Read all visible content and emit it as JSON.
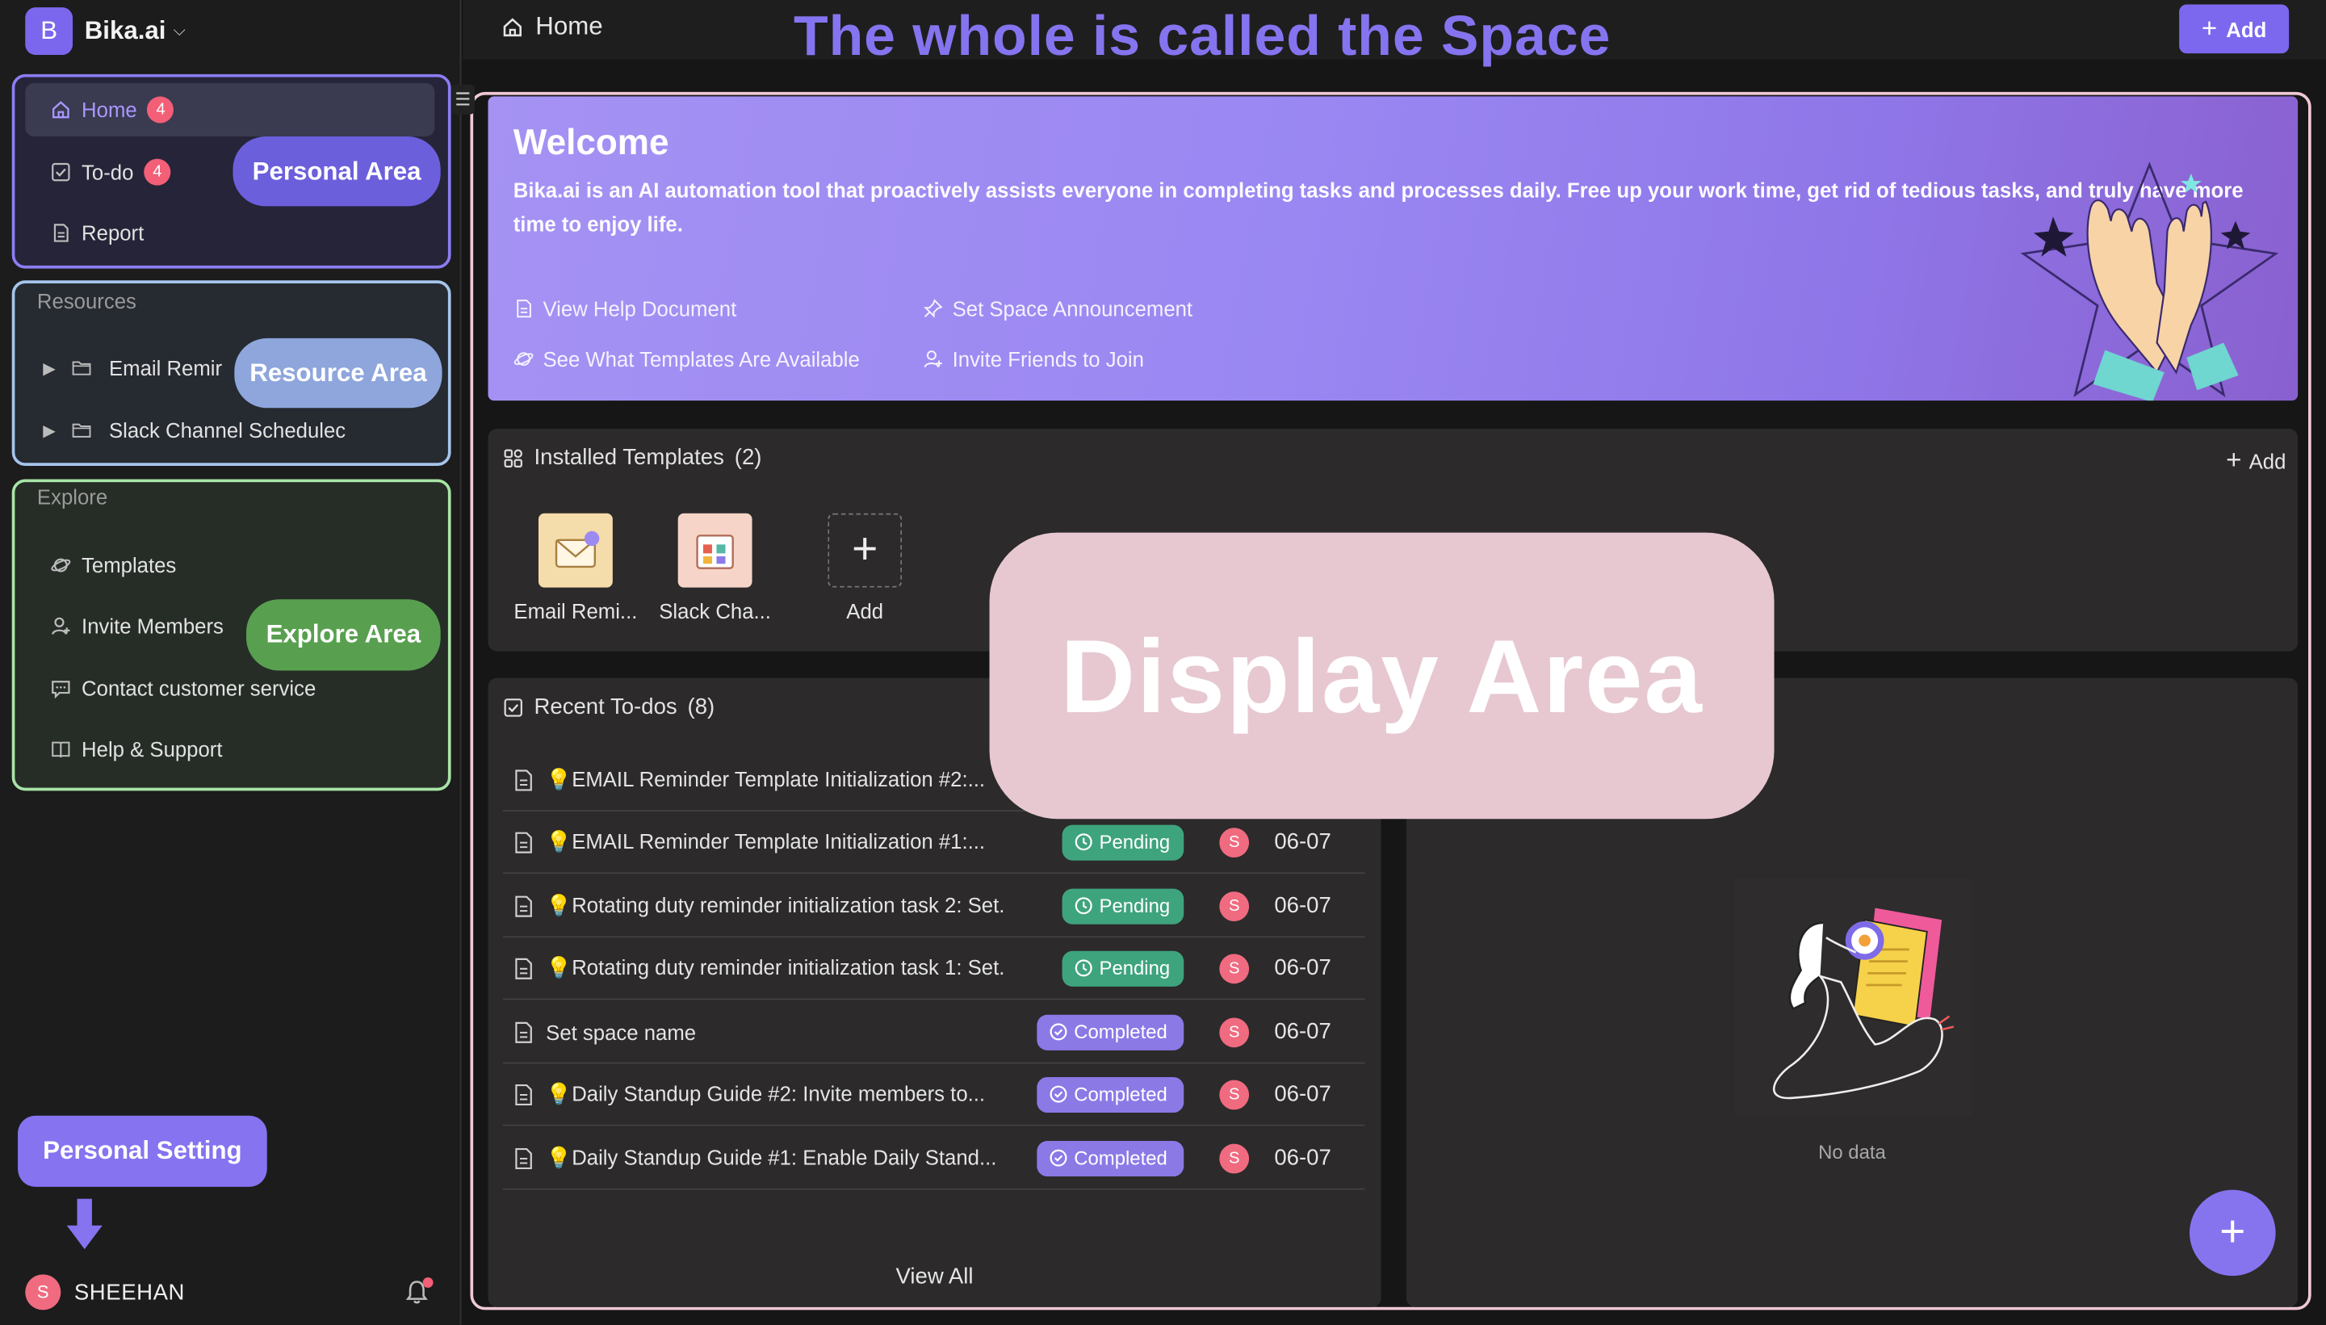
{
  "app": {
    "logo_letter": "B",
    "name": "Bika.ai"
  },
  "sidebar": {
    "personal": [
      {
        "label": "Home",
        "badge": "4"
      },
      {
        "label": "To-do",
        "badge": "4"
      },
      {
        "label": "Report"
      }
    ],
    "resources_title": "Resources",
    "resources": [
      "Email Remir",
      "Slack Channel Schedulec"
    ],
    "explore_title": "Explore",
    "explore": [
      "Templates",
      "Invite Members",
      "Contact customer service",
      "Help & Support"
    ],
    "user": {
      "initial": "S",
      "name": "SHEEHAN"
    }
  },
  "annotations": {
    "personal_area": "Personal Area",
    "resource_area": "Resource Area",
    "explore_area": "Explore Area",
    "personal_setting": "Personal Setting",
    "space_title": "The whole is called the Space",
    "display_area": "Display Area"
  },
  "header": {
    "breadcrumb": "Home",
    "add_label": "Add"
  },
  "welcome": {
    "title": "Welcome",
    "description": "Bika.ai is an AI automation tool that proactively assists everyone in completing tasks and processes daily. Free up your work time, get rid of tedious tasks, and truly have more time to enjoy life.",
    "links": [
      "View Help Document",
      "Set Space Announcement",
      "See What Templates Are Available",
      "Invite Friends to Join"
    ]
  },
  "installed": {
    "title": "Installed Templates",
    "count": "(2)",
    "add_label": "Add",
    "items": [
      "Email Remi...",
      "Slack Cha...",
      "Add"
    ]
  },
  "todos": {
    "title": "Recent To-dos",
    "count": "(8)",
    "view_all": "View All",
    "rows": [
      {
        "title": "💡EMAIL Reminder Template Initialization #2:...",
        "status": "",
        "avatar": "",
        "date": ""
      },
      {
        "title": "💡EMAIL Reminder Template Initialization #1:...",
        "status": "Pending",
        "avatar": "S",
        "date": "06-07"
      },
      {
        "title": "💡Rotating duty reminder initialization task 2: Set...",
        "status": "Pending",
        "avatar": "S",
        "date": "06-07"
      },
      {
        "title": "💡Rotating duty reminder initialization task 1: Set...",
        "status": "Pending",
        "avatar": "S",
        "date": "06-07"
      },
      {
        "title": "Set space name",
        "status": "Completed",
        "avatar": "S",
        "date": "06-07"
      },
      {
        "title": "💡Daily Standup Guide #2: Invite members to...",
        "status": "Completed",
        "avatar": "S",
        "date": "06-07"
      },
      {
        "title": "💡Daily Standup Guide #1: Enable Daily Stand...",
        "status": "Completed",
        "avatar": "S",
        "date": "06-07"
      }
    ]
  },
  "right_panel": {
    "empty_text": "No data"
  },
  "fab_label": "+",
  "colors": {
    "accent": "#7c68ee",
    "pending": "#3ea47e",
    "completed": "#8b79e6",
    "badge": "#f25f76"
  }
}
